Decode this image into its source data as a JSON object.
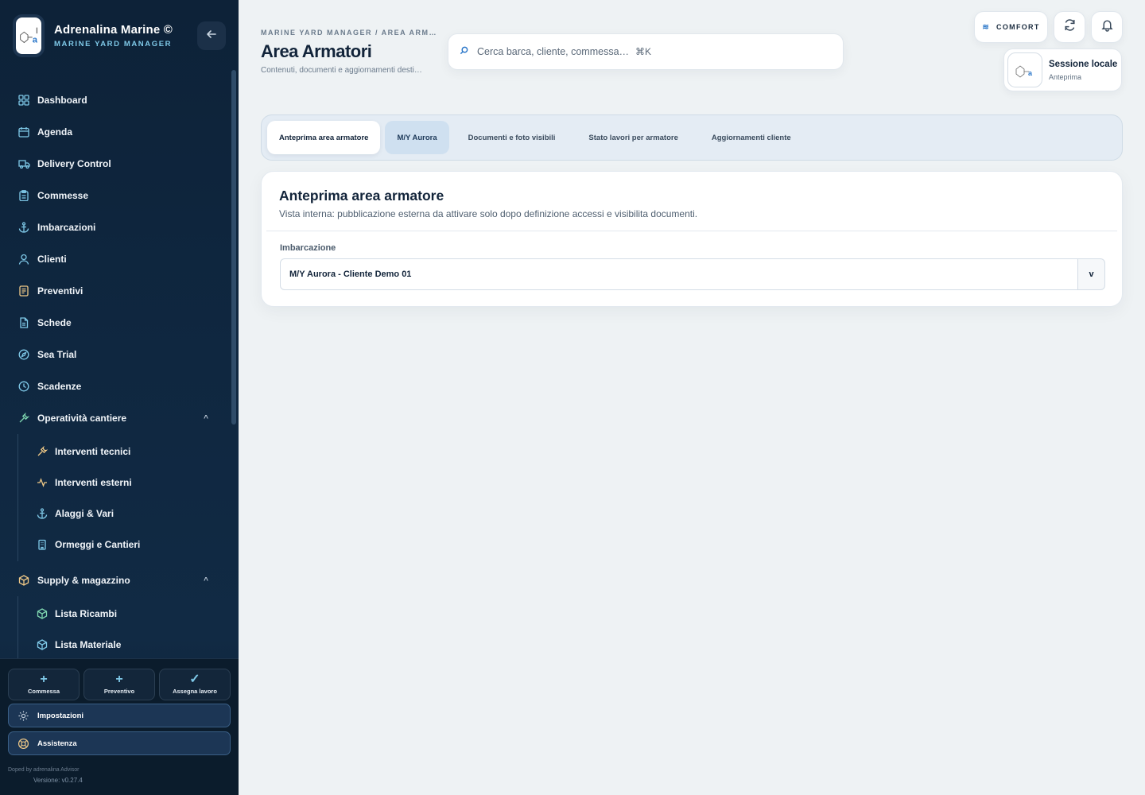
{
  "app": {
    "name": "Adrenalina Marine ©",
    "subtitle": "MARINE YARD MANAGER"
  },
  "colors": {
    "sidebar_bg": "#0f2740",
    "accent": "#7fc9e8",
    "link_blue": "#2b77c9",
    "page_bg": "#eef2f4"
  },
  "sidebar": {
    "items": [
      {
        "label": "Dashboard",
        "icon": "grid-icon"
      },
      {
        "label": "Agenda",
        "icon": "calendar-icon"
      },
      {
        "label": "Delivery Control",
        "icon": "truck-icon"
      },
      {
        "label": "Commesse",
        "icon": "clipboard-icon"
      },
      {
        "label": "Imbarcazioni",
        "icon": "anchor-icon"
      },
      {
        "label": "Clienti",
        "icon": "user-icon"
      },
      {
        "label": "Preventivi",
        "icon": "receipt-icon"
      },
      {
        "label": "Schede",
        "icon": "file-icon"
      },
      {
        "label": "Sea Trial",
        "icon": "compass-icon"
      },
      {
        "label": "Scadenze",
        "icon": "clock-icon"
      }
    ],
    "groups": [
      {
        "label": "Operatività cantiere",
        "icon": "wrench-icon",
        "chevron": "^",
        "items": [
          {
            "label": "Interventi tecnici",
            "icon": "wrench-icon"
          },
          {
            "label": "Interventi esterni",
            "icon": "activity-icon"
          },
          {
            "label": "Alaggi & Vari",
            "icon": "anchor-icon"
          },
          {
            "label": "Ormeggi e Cantieri",
            "icon": "building-icon"
          }
        ]
      },
      {
        "label": "Supply & magazzino",
        "icon": "box-icon",
        "chevron": "^",
        "items": [
          {
            "label": "Lista Ricambi",
            "icon": "box-icon"
          },
          {
            "label": "Lista Materiale",
            "icon": "box-icon"
          }
        ]
      }
    ],
    "quick_actions": [
      {
        "label": "Commessa",
        "glyph": "+"
      },
      {
        "label": "Preventivo",
        "glyph": "+"
      },
      {
        "label": "Assegna lavoro",
        "glyph": "✓"
      }
    ],
    "settings_label": "Impostazioni",
    "support_label": "Assistenza",
    "footer_credit": "Doped by adrenalina Advisor",
    "version": "Versione: v0.27.4"
  },
  "header": {
    "breadcrumb": "MARINE YARD MANAGER  /  AREA ARM…",
    "title": "Area Armatori",
    "subtitle": "Contenuti, documenti e aggiornamenti desti…",
    "search_placeholder": "Cerca barca, cliente, commessa…",
    "search_shortcut": "⌘K",
    "comfort_label": "COMFORT",
    "session_title": "Sessione locale",
    "session_sub": "Anteprima"
  },
  "tabs": [
    {
      "label": "Anteprima area armatore",
      "state": "active"
    },
    {
      "label": "M/Y Aurora",
      "state": "selected"
    },
    {
      "label": "Documenti e foto visibili",
      "state": "plain"
    },
    {
      "label": "Stato lavori per armatore",
      "state": "plain"
    },
    {
      "label": "Aggiornamenti cliente",
      "state": "plain"
    }
  ],
  "card": {
    "title": "Anteprima area armatore",
    "description": "Vista interna: pubblicazione esterna da attivare solo dopo definizione accessi e visibilita documenti.",
    "field_label": "Imbarcazione",
    "select_value": "M/Y Aurora - Cliente Demo 01",
    "select_toggle": "v"
  }
}
